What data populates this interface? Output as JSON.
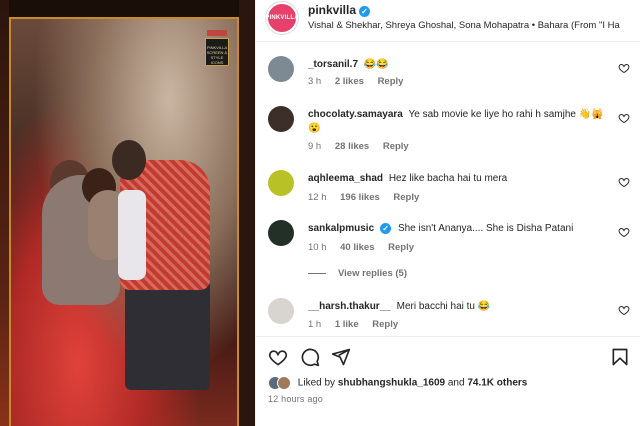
{
  "post": {
    "account": "pinkvilla",
    "avatar_text": "PINKVILLA",
    "audio": "Vishal & Shekhar, Shreya Ghoshal, Sona Mohapatra • Bahara (From \"I Ha",
    "verified_icon": "verified-badge-icon"
  },
  "media": {
    "badge_text": "PINKVILLA SCREEN & STYLE ICONS"
  },
  "comments": [
    {
      "user": "_torsanil.7",
      "text": "😂😂",
      "time": "3 h",
      "likes": "2 likes",
      "reply": "Reply",
      "avatar_color": "#7d8a93"
    },
    {
      "user": "chocolaty.samayara",
      "text": "Ye sab movie ke liye ho rahi h samjhe 👋🙀😮",
      "time": "9 h",
      "likes": "28 likes",
      "reply": "Reply",
      "avatar_color": "#3c2f2a"
    },
    {
      "user": "aqhleema_shad",
      "text": "Hez like bacha hai tu mera",
      "time": "12 h",
      "likes": "196 likes",
      "reply": "Reply",
      "avatar_color": "#b8c227"
    },
    {
      "user": "sankalpmusic",
      "text": "She isn't Ananya.... She is Disha Patani",
      "time": "10 h",
      "likes": "40 likes",
      "reply": "Reply",
      "avatar_color": "#223028",
      "verified": true
    },
    {
      "user": "__harsh.thakur__",
      "text": "Meri bacchi hai tu 😂",
      "time": "1 h",
      "likes": "1 like",
      "reply": "Reply",
      "avatar_color": "#d8d4cf"
    }
  ],
  "view_replies": "View replies (5)",
  "likes": {
    "prefix": "Liked by",
    "user": "shubhangshukla_1609",
    "middle": "and",
    "count": "74.1K others"
  },
  "timestamp": "12 hours ago",
  "icons": {
    "like": "heart-icon",
    "comment": "comment-icon",
    "share": "send-icon",
    "save": "bookmark-icon"
  }
}
